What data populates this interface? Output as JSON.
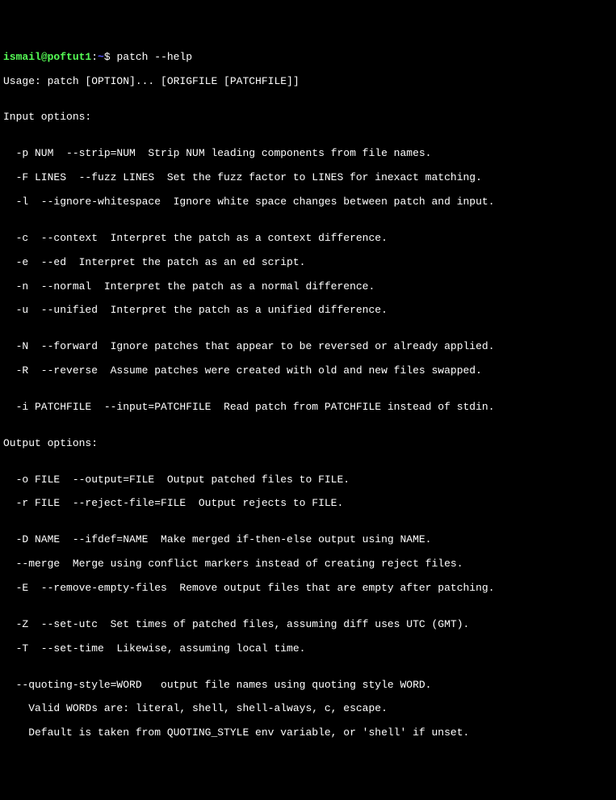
{
  "prompt": {
    "user": "ismail",
    "at": "@",
    "host": "poftut1",
    "colon": ":",
    "path": "~",
    "dollar": "$ "
  },
  "command": "patch --help",
  "output": {
    "usage": "Usage: patch [OPTION]... [ORIGFILE [PATCHFILE]]",
    "blank1": "",
    "input_header": "Input options:",
    "blank2": "",
    "p_opt": "  -p NUM  --strip=NUM  Strip NUM leading components from file names.",
    "f_opt": "  -F LINES  --fuzz LINES  Set the fuzz factor to LINES for inexact matching.",
    "l_opt": "  -l  --ignore-whitespace  Ignore white space changes between patch and input.",
    "blank3": "",
    "c_opt": "  -c  --context  Interpret the patch as a context difference.",
    "e_opt": "  -e  --ed  Interpret the patch as an ed script.",
    "n_opt": "  -n  --normal  Interpret the patch as a normal difference.",
    "u_opt": "  -u  --unified  Interpret the patch as a unified difference.",
    "blank4": "",
    "N_opt": "  -N  --forward  Ignore patches that appear to be reversed or already applied.",
    "R_opt": "  -R  --reverse  Assume patches were created with old and new files swapped.",
    "blank5": "",
    "i_opt": "  -i PATCHFILE  --input=PATCHFILE  Read patch from PATCHFILE instead of stdin.",
    "blank6": "",
    "output_header": "Output options:",
    "blank7": "",
    "o_opt": "  -o FILE  --output=FILE  Output patched files to FILE.",
    "r_opt": "  -r FILE  --reject-file=FILE  Output rejects to FILE.",
    "blank8": "",
    "D_opt": "  -D NAME  --ifdef=NAME  Make merged if-then-else output using NAME.",
    "merge_opt": "  --merge  Merge using conflict markers instead of creating reject files.",
    "E_opt": "  -E  --remove-empty-files  Remove output files that are empty after patching.",
    "blank9": "",
    "Z_opt": "  -Z  --set-utc  Set times of patched files, assuming diff uses UTC (GMT).",
    "T_opt": "  -T  --set-time  Likewise, assuming local time.",
    "blank10": "",
    "quoting_opt": "  --quoting-style=WORD   output file names using quoting style WORD.",
    "valid_words": "    Valid WORDs are: literal, shell, shell-always, c, escape.",
    "default_word": "    Default is taken from QUOTING_STYLE env variable, or 'shell' if unset."
  }
}
